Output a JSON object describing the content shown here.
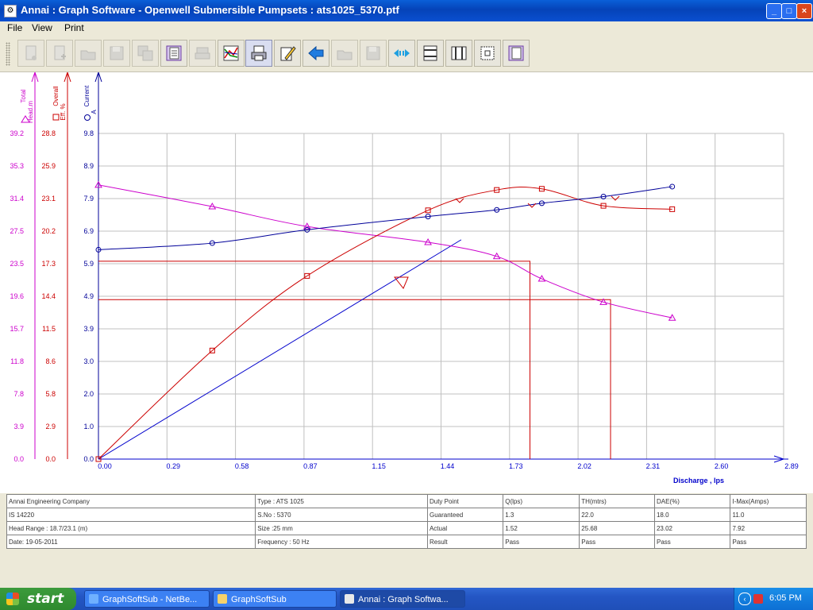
{
  "window": {
    "title": "Annai : Graph Software - Openwell Submersible Pumpsets  :  ats1025_5370.ptf",
    "icon": "app-icon",
    "minimize_label": "_",
    "maximize_label": "□",
    "close_label": "×"
  },
  "menu": {
    "file": "File",
    "view": "View",
    "print": "Print"
  },
  "toolbar": {
    "buttons": [
      {
        "icon": "new-document-icon",
        "enabled": false
      },
      {
        "icon": "new-document-add-icon",
        "enabled": false
      },
      {
        "icon": "open-folder-icon",
        "enabled": false
      },
      {
        "icon": "save-icon",
        "enabled": false
      },
      {
        "icon": "save-all-icon",
        "enabled": false
      },
      {
        "icon": "page-layout-icon",
        "enabled": true
      },
      {
        "icon": "print-icon",
        "enabled": false
      },
      {
        "icon": "graph-icon",
        "enabled": true
      },
      {
        "icon": "printer-icon",
        "enabled": true,
        "active": true
      },
      {
        "icon": "edit-icon",
        "enabled": true
      },
      {
        "icon": "back-arrow-icon",
        "enabled": true
      },
      {
        "icon": "open-folder-2-icon",
        "enabled": false
      },
      {
        "icon": "save-2-icon",
        "enabled": false
      },
      {
        "icon": "expand-horizontal-icon",
        "enabled": true
      },
      {
        "icon": "horizontal-lines-icon",
        "enabled": true
      },
      {
        "icon": "vertical-lines-icon",
        "enabled": true
      },
      {
        "icon": "frame-icon",
        "enabled": true
      },
      {
        "icon": "page-view-icon",
        "enabled": true
      }
    ]
  },
  "chart_data": {
    "type": "line",
    "xlabel": "Discharge , lps",
    "x_ticks": [
      "0.00",
      "0.29",
      "0.58",
      "0.87",
      "1.15",
      "1.44",
      "1.73",
      "2.02",
      "2.31",
      "2.60",
      "2.89"
    ],
    "xlim": [
      0,
      2.89
    ],
    "axes": [
      {
        "name": "Total Head.m",
        "color": "#cc00cc",
        "symbol": "triangle",
        "ticks": [
          "0.0",
          "3.9",
          "7.8",
          "11.8",
          "15.7",
          "19.6",
          "23.5",
          "27.5",
          "31.4",
          "35.3",
          "39.2"
        ],
        "ylim": [
          0,
          39.2
        ]
      },
      {
        "name": "Overall Eff. %",
        "color": "#cc0000",
        "symbol": "square",
        "ticks": [
          "0.0",
          "2.9",
          "5.8",
          "8.6",
          "11.5",
          "14.4",
          "17.3",
          "20.2",
          "23.1",
          "25.9",
          "28.8"
        ],
        "ylim": [
          0,
          28.8
        ]
      },
      {
        "name": "Current A",
        "color": "#000099",
        "symbol": "circle",
        "ticks": [
          "0.0",
          "1.0",
          "2.0",
          "3.0",
          "3.9",
          "4.9",
          "5.9",
          "6.9",
          "7.9",
          "8.9",
          "9.8"
        ],
        "ylim": [
          0,
          9.8
        ]
      }
    ],
    "series": [
      {
        "name": "Total Head.m",
        "color": "#cc00cc",
        "marker": "triangle",
        "x": [
          0.0,
          0.48,
          0.88,
          1.39,
          1.68,
          1.87,
          2.13,
          2.42
        ],
        "y": [
          33.0,
          30.4,
          28.0,
          26.1,
          24.4,
          21.7,
          18.9,
          17.0
        ]
      },
      {
        "name": "Overall Eff. %",
        "color": "#cc0000",
        "marker": "square",
        "x": [
          0.0,
          0.48,
          0.88,
          1.39,
          1.68,
          1.87,
          2.13,
          2.42
        ],
        "y": [
          0.0,
          9.6,
          16.2,
          22.0,
          23.8,
          23.9,
          22.4,
          22.1
        ]
      },
      {
        "name": "Current A",
        "color": "#000099",
        "marker": "circle",
        "x": [
          0.0,
          0.48,
          0.88,
          1.39,
          1.68,
          1.87,
          2.13,
          2.42
        ],
        "y": [
          6.3,
          6.5,
          6.9,
          7.3,
          7.5,
          7.7,
          7.9,
          8.2
        ]
      }
    ],
    "duty_lines": [
      {
        "x": 1.82,
        "eff": 17.5
      },
      {
        "x": 2.16,
        "eff": 14.1
      }
    ],
    "eff_line": {
      "x": [
        0.0,
        1.53
      ],
      "current": [
        0.0,
        6.6
      ]
    },
    "grid": true
  },
  "info": {
    "rows": [
      [
        "Annai  Engineering  Company",
        "Type : ATS 1025",
        "Duty Point",
        "Q(lps)",
        "TH(mtrs)",
        "DAE(%)",
        "I-Max(Amps)"
      ],
      [
        "IS 14220",
        "S.No : 5370",
        "Guaranteed",
        "1.3",
        "22.0",
        "18.0",
        "11.0"
      ],
      [
        "Head Range : 18.7/23.1  (m)",
        "Size :25 mm",
        "Actual",
        "1.52",
        "25.68",
        "23.02",
        "7.92"
      ],
      [
        "Date: 19-05-2011",
        "Frequency : 50 Hz",
        "Result",
        "Pass",
        "Pass",
        "Pass",
        "Pass"
      ]
    ]
  },
  "taskbar": {
    "start_label": "start",
    "tasks": [
      {
        "label": "GraphSoftSub - NetBe...",
        "icon": "netbeans-icon",
        "active": false
      },
      {
        "label": "GraphSoftSub",
        "icon": "folder-icon",
        "active": false
      },
      {
        "label": "Annai : Graph Softwa...",
        "icon": "app-icon",
        "active": true
      }
    ],
    "clock": "6:05 PM"
  }
}
